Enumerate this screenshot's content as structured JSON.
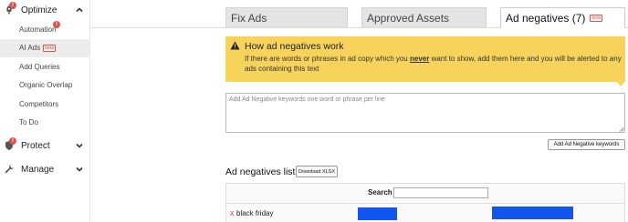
{
  "sidebar": {
    "optimize": {
      "label": "Optimize",
      "badge": "!"
    },
    "optimize_items": [
      {
        "label": "Automation",
        "badge": "!"
      },
      {
        "label": "AI Ads",
        "tag": "beta"
      },
      {
        "label": "Add Queries"
      },
      {
        "label": "Organic Overlap"
      },
      {
        "label": "Competitors"
      },
      {
        "label": "To Do"
      }
    ],
    "protect": {
      "label": "Protect",
      "badge": "!"
    },
    "manage": {
      "label": "Manage"
    }
  },
  "tabs": [
    {
      "label": "Fix Ads"
    },
    {
      "label": "Approved Assets"
    },
    {
      "label": "Ad negatives (7)",
      "tag": "beta"
    }
  ],
  "alert": {
    "title": "How ad negatives work",
    "body_before": "If there are words or phrases in ad copy which you ",
    "body_emph": "never",
    "body_after": " want to show, add them here and you will be alerted to any ads containing this text"
  },
  "keywords_input": {
    "placeholder": "Add Ad Negative keywords one word or phrase per line",
    "value": ""
  },
  "add_button": "Add Ad Negative keywords",
  "list": {
    "title": "Ad negatives list",
    "download_button": "Download XLSX",
    "search_label": "Search",
    "search_value": "",
    "rows": [
      {
        "remove": "x",
        "keyword": "black friday"
      }
    ]
  },
  "colors": {
    "alert_bg": "#f7d35c",
    "accent_red": "#d9534f",
    "bar_blue": "#1155ee"
  }
}
